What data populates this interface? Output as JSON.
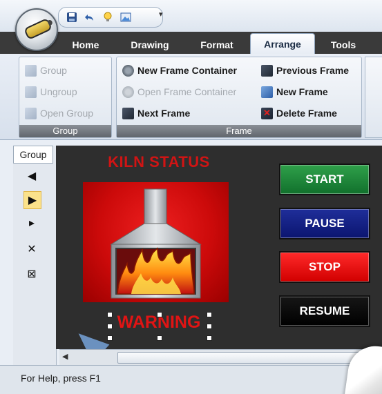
{
  "app": {
    "quick_access": {
      "icons": [
        "save-icon",
        "undo-icon",
        "lightbulb-icon",
        "picture-icon"
      ],
      "more_glyph": "▾"
    }
  },
  "tabs": [
    {
      "label": "Home",
      "active": false
    },
    {
      "label": "Drawing",
      "active": false
    },
    {
      "label": "Format",
      "active": false
    },
    {
      "label": "Arrange",
      "active": true
    },
    {
      "label": "Tools",
      "active": false
    }
  ],
  "ribbon": {
    "group_group": {
      "title": "Group",
      "items": [
        {
          "label": "Group",
          "enabled": false,
          "icon": "group-icon"
        },
        {
          "label": "Ungroup",
          "enabled": false,
          "icon": "ungroup-icon"
        },
        {
          "label": "Open Group",
          "enabled": false,
          "icon": "open-group-icon"
        }
      ]
    },
    "group_frame": {
      "title": "Frame",
      "items": [
        {
          "label": "New Frame Container",
          "enabled": true,
          "icon": "frame-container-icon"
        },
        {
          "label": "Open Frame Container",
          "enabled": false,
          "icon": "open-frame-container-icon"
        },
        {
          "label": "Next Frame",
          "enabled": true,
          "icon": "next-frame-icon"
        },
        {
          "label": "Previous Frame",
          "enabled": true,
          "icon": "previous-frame-icon"
        },
        {
          "label": "New Frame",
          "enabled": true,
          "icon": "new-frame-icon"
        },
        {
          "label": "Delete Frame",
          "enabled": true,
          "icon": "delete-frame-icon"
        }
      ]
    }
  },
  "side_panel": {
    "title": "Group",
    "tools": [
      {
        "icon": "triangle-left-icon",
        "glyph": "◀"
      },
      {
        "icon": "play-icon",
        "glyph": "▶",
        "selected": true
      },
      {
        "icon": "play-star-icon",
        "glyph": "▸"
      },
      {
        "icon": "close-icon",
        "glyph": "✕"
      },
      {
        "icon": "boxed-x-icon",
        "glyph": "⊠"
      }
    ]
  },
  "canvas": {
    "title": "KILN STATUS",
    "warning": "WARNING",
    "buttons": {
      "start": "START",
      "pause": "PAUSE",
      "stop": "STOP",
      "resume": "RESUME"
    },
    "colors": {
      "title_red": "#d01414",
      "start_green": "#1a8a38",
      "pause_blue": "#14208a",
      "stop_red": "#e80000",
      "resume_black": "#0a0a0a"
    }
  },
  "status_bar": {
    "text": "For Help, press F1"
  }
}
